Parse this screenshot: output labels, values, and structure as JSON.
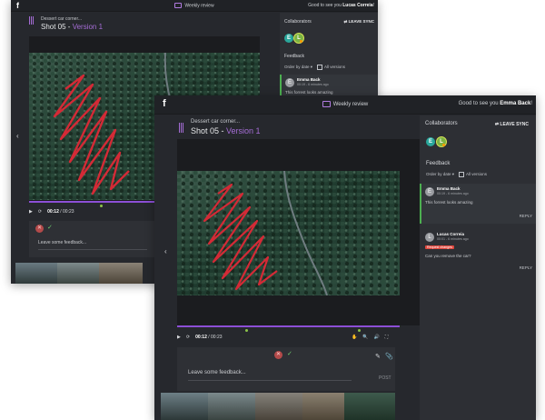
{
  "app": {
    "logo": "f",
    "colors": {
      "accent": "#8c4fd6",
      "bg": "#26282d",
      "sidebar": "#2d2f34",
      "annotation": "#d42a36",
      "selected": "#4caf50"
    }
  },
  "back": {
    "topbar": {
      "title": "Weekly review",
      "greeting": "Good to see you",
      "user": "Lucas Correia"
    },
    "breadcrumb": "Dessert car corner...",
    "shot_title": "Shot 05 - ",
    "shot_version": "Version 1",
    "player": {
      "time_current": "00:12",
      "time_total": "00:23"
    },
    "feedback_placeholder": "Leave some feedback...",
    "sidebar": {
      "collaborators_label": "Collaborators",
      "leave_sync": "LEAVE SYNC",
      "avatars": [
        "E",
        "L"
      ],
      "feedback_label": "Feedback",
      "order_label": "Order by date",
      "all_versions": "All versions",
      "comments": [
        {
          "avatar": "E",
          "name": "Emma Back",
          "meta": "00:19 - 6 minutes ago",
          "text": "This forrest looks amazing"
        }
      ]
    }
  },
  "front": {
    "topbar": {
      "title": "Weekly review",
      "greeting": "Good to see you",
      "user": "Emma Back"
    },
    "breadcrumb": "Dessert car corner...",
    "shot_title": "Shot 05 - ",
    "shot_version": "Version 1",
    "player": {
      "time_current": "00:12",
      "time_total": "00:23"
    },
    "feedback_placeholder": "Leave some feedback...",
    "post_label": "POST",
    "sidebar": {
      "collaborators_label": "Collaborators",
      "leave_sync": "LEAVE SYNC",
      "avatars": [
        "E",
        "L"
      ],
      "feedback_label": "Feedback",
      "order_label": "Order by date",
      "all_versions": "All versions",
      "comments": [
        {
          "avatar": "E",
          "name": "Emma Back",
          "meta": "00:19 - 6 minutes ago",
          "text": "This forrest looks amazing",
          "reply": "REPLY"
        },
        {
          "avatar": "L",
          "name": "Lucas Correia",
          "meta": "00:01 - 6 minutes ago",
          "tag": "Request changes",
          "text": "Can you remove the car?",
          "reply": "REPLY"
        }
      ]
    }
  },
  "icons": {
    "play": "▶",
    "loop": "⟳",
    "volume": "🔊",
    "fullscreen": "⛶",
    "hand": "✋",
    "search": "🔍",
    "left": "‹",
    "right": "›",
    "close": "✕",
    "check": "✓",
    "pencil": "✎",
    "clip": "📎"
  }
}
